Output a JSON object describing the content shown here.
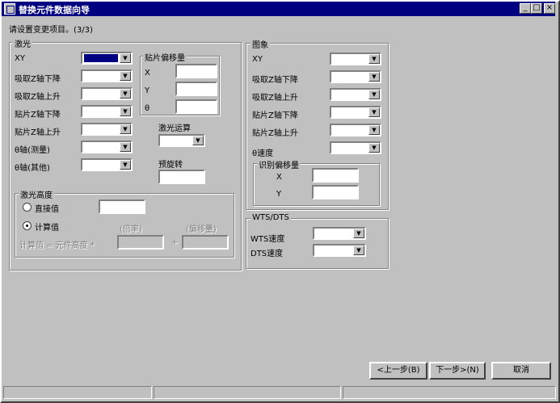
{
  "window": {
    "title": "替换元件数据向导",
    "minimize": "_",
    "maximize": "□",
    "close": "×"
  },
  "instruction": "请设置变更项目。(3/3)",
  "laser": {
    "title": "激光",
    "rows": [
      {
        "label": "XY"
      },
      {
        "label": "吸取Z轴下降"
      },
      {
        "label": "吸取Z轴上升"
      },
      {
        "label": "贴片Z轴下降"
      },
      {
        "label": "贴片Z轴上升"
      },
      {
        "label": "θ轴(测量)"
      },
      {
        "label": "θ轴(其他)"
      }
    ],
    "offset": {
      "title": "贴片偏移量",
      "x_label": "X",
      "y_label": "Y",
      "theta_label": "θ"
    },
    "calc_label": "激光运算",
    "prerotate_label": "预旋转",
    "height": {
      "title": "激光高度",
      "direct_label": "直接值",
      "calc_label": "计算值",
      "magnification_label": "(倍率)",
      "offset_label": "(偏移量)",
      "formula_label": "计算值 = 元件高度 *",
      "plus_label": "+"
    }
  },
  "image": {
    "title": "图象",
    "rows": [
      {
        "label": "XY"
      },
      {
        "label": "吸取Z轴下降"
      },
      {
        "label": "吸取Z轴上升"
      },
      {
        "label": "贴片Z轴下降"
      },
      {
        "label": "贴片Z轴上升"
      },
      {
        "label": "θ速度"
      }
    ],
    "recog_offset": {
      "title": "识别偏移量",
      "x_label": "X",
      "y_label": "Y"
    }
  },
  "wts": {
    "title": "WTS/DTS",
    "wts_label": "WTS速度",
    "dts_label": "DTS速度"
  },
  "buttons": {
    "back": "<上一步(B)",
    "next": "下一步>(N)",
    "cancel": "取消"
  },
  "arrow_glyph": "▼"
}
